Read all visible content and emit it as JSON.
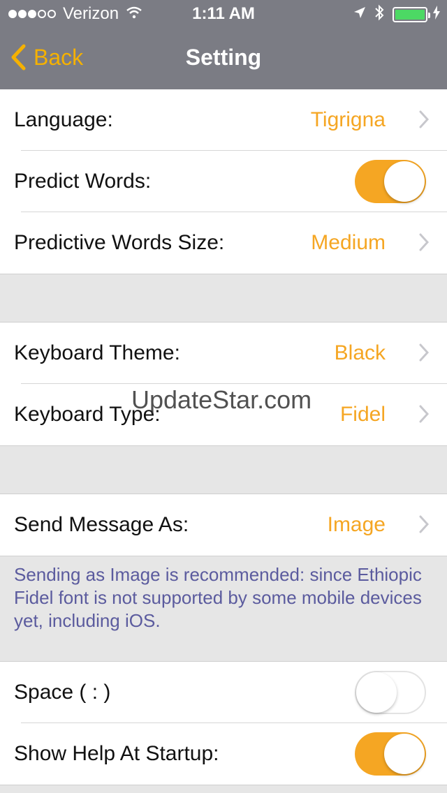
{
  "status_bar": {
    "carrier": "Verizon",
    "time": "1:11 AM",
    "signal_icon": "signal-dots-icon",
    "wifi_icon": "wifi-icon",
    "location_icon": "location-arrow-icon",
    "bluetooth_icon": "bluetooth-icon",
    "battery_icon": "battery-icon",
    "battery_color": "#4cd964"
  },
  "nav": {
    "back_label": "Back",
    "title": "Setting",
    "accent": "#f5b100"
  },
  "groups": {
    "first": {
      "language_label": "Language:",
      "language_value": "Tigrigna",
      "predict_label": "Predict Words:",
      "predict_on": true,
      "size_label": "Predictive Words Size:",
      "size_value": "Medium"
    },
    "keyboard": {
      "theme_label": "Keyboard Theme:",
      "theme_value": "Black",
      "type_label": "Keyboard Type:",
      "type_value": "Fidel"
    },
    "message": {
      "send_label": "Send Message As:",
      "send_value": "Image",
      "note": "Sending as Image is recommended: since Ethiopic Fidel font is not supported by some mobile devices yet, including iOS."
    },
    "misc": {
      "space_label": "Space ( : )",
      "space_on": false,
      "help_label": "Show Help At Startup:",
      "help_on": true
    }
  },
  "watermark": "UpdateStar.com",
  "colors": {
    "header_bg": "#7b7c84",
    "value_text": "#f5a623",
    "toggle_on": "#f5a623",
    "note_text": "#5b5b9e"
  }
}
